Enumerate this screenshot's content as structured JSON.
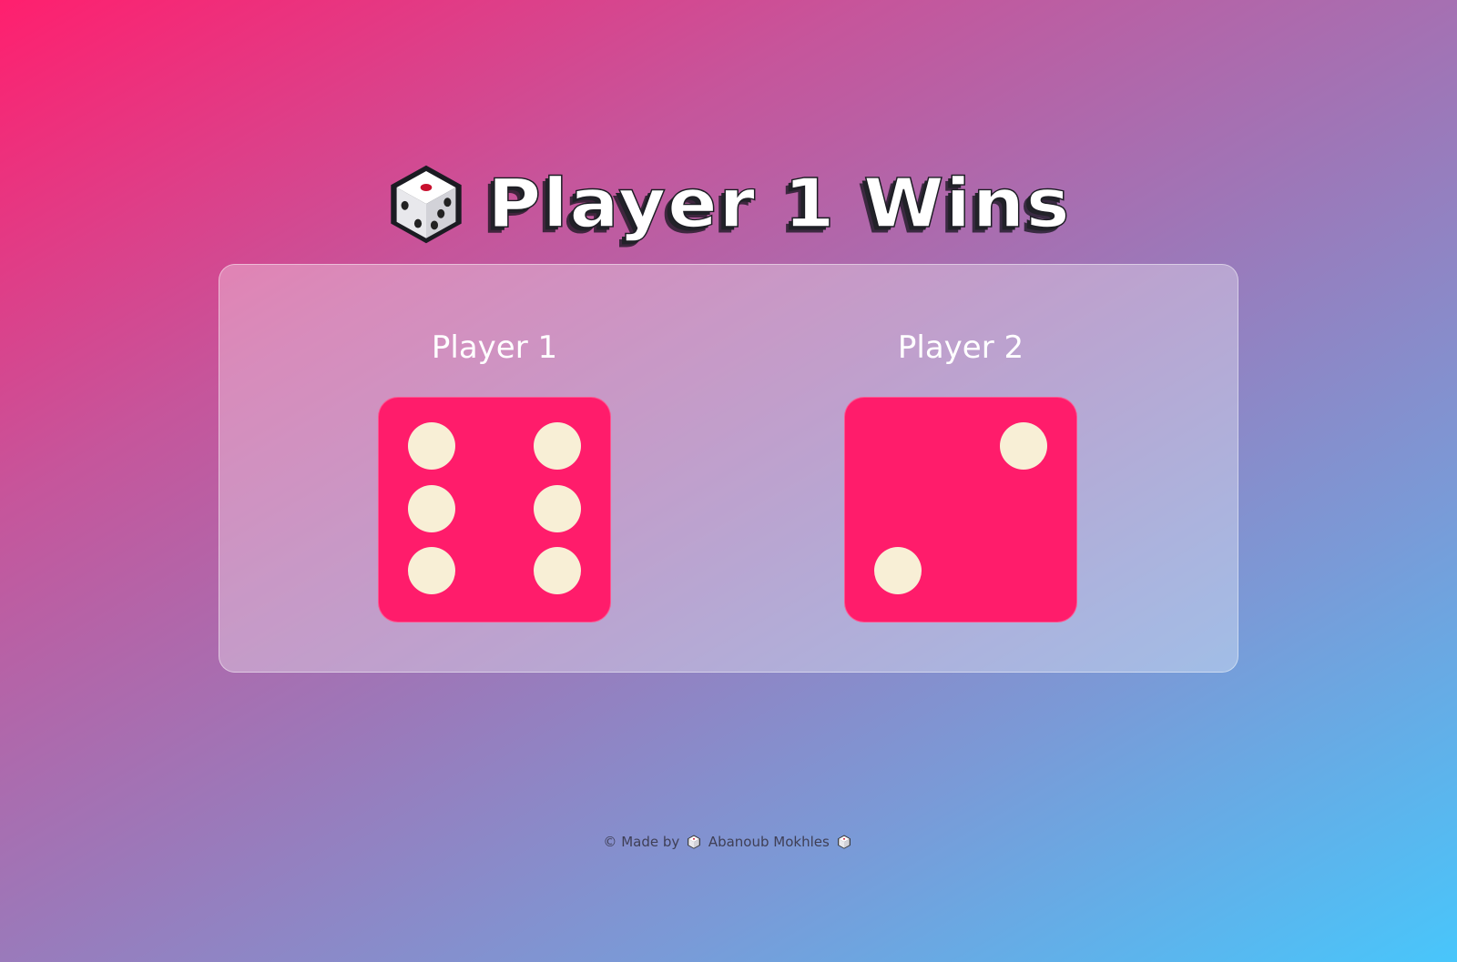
{
  "header": {
    "title": "Player 1 Wins",
    "icon": "game-die-icon"
  },
  "players": [
    {
      "label": "Player 1",
      "die_value": 6
    },
    {
      "label": "Player 2",
      "die_value": 2
    }
  ],
  "footer": {
    "prefix": "© Made by",
    "author": "Abanoub Mokhles",
    "icon": "game-die-icon"
  },
  "colors": {
    "die_face": "#ff1c6b",
    "pip": "#f8efd6",
    "gradient_start": "#ff1f6e",
    "gradient_end": "#48c6fb"
  }
}
